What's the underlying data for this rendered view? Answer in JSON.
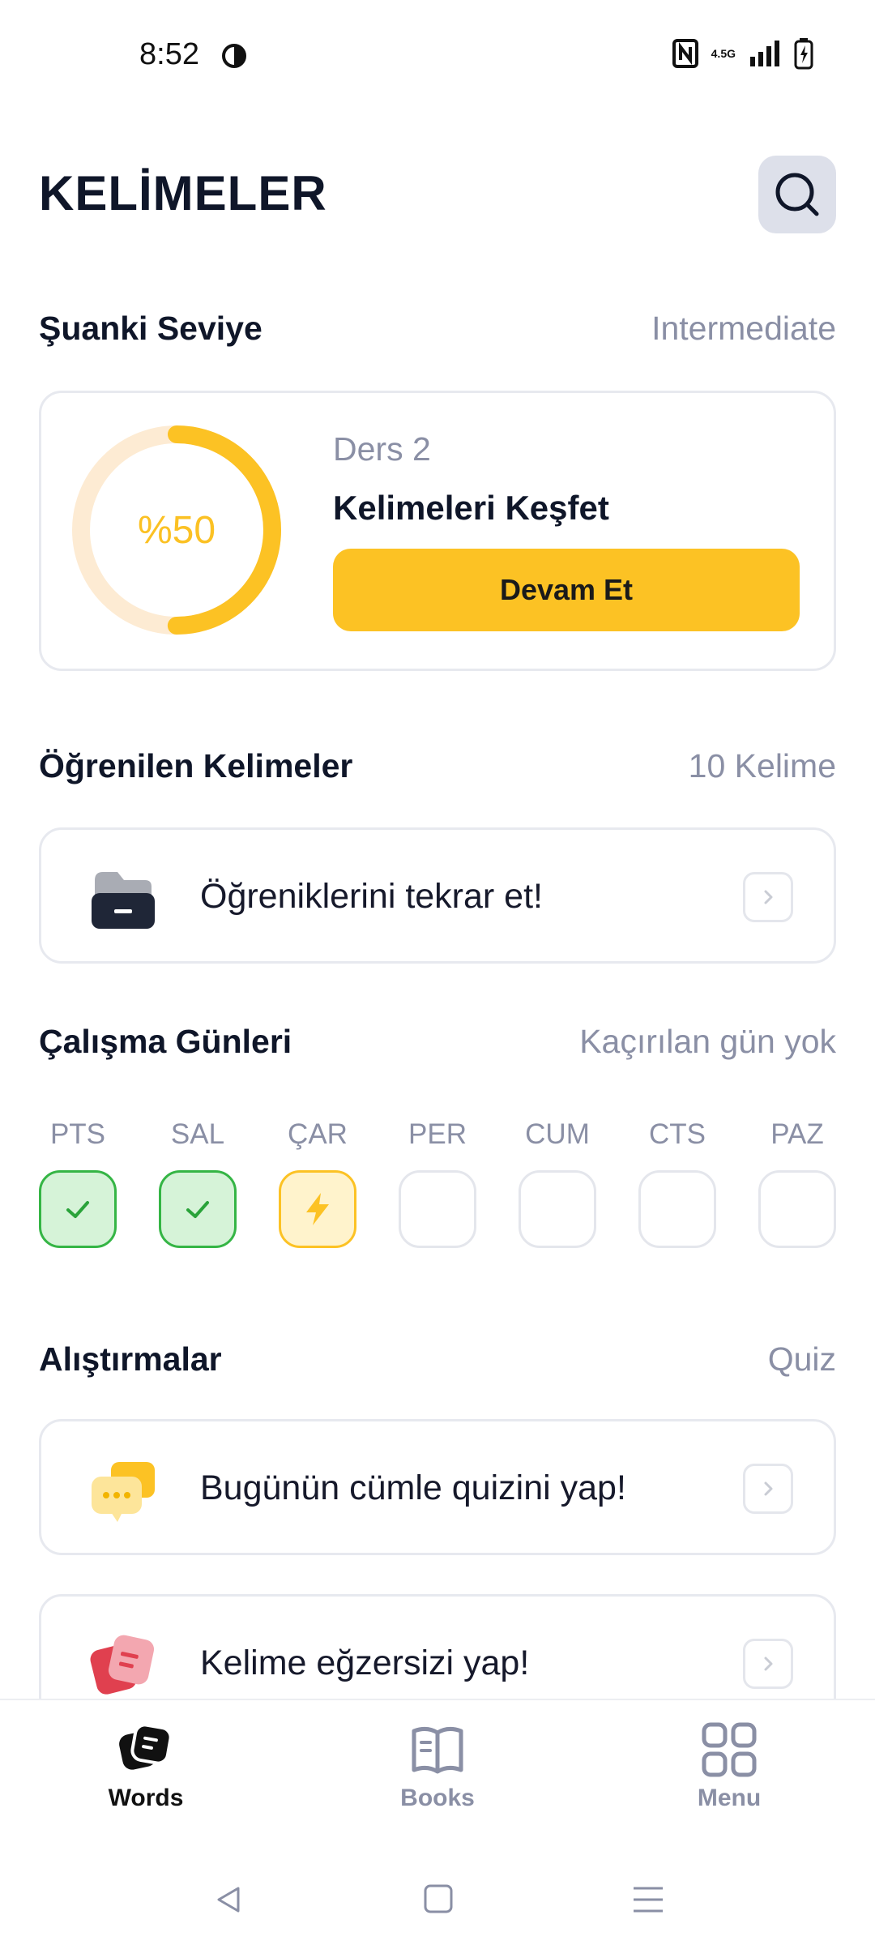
{
  "status": {
    "time": "8:52",
    "network": "4.5G"
  },
  "header": {
    "title": "KELİMELER"
  },
  "level": {
    "label": "Şuanki Seviye",
    "value": "Intermediate",
    "progress_text": "%50",
    "progress": 0.5,
    "lesson_sub": "Ders 2",
    "lesson_name": "Kelimeleri Keşfet",
    "continue_label": "Devam Et"
  },
  "learned": {
    "label": "Öğrenilen Kelimeler",
    "count": "10 Kelime",
    "review_label": "Öğreniklerini tekrar et!"
  },
  "study_days": {
    "label": "Çalışma Günleri",
    "status": "Kaçırılan gün yok",
    "days": [
      {
        "name": "PTS",
        "state": "done"
      },
      {
        "name": "SAL",
        "state": "done"
      },
      {
        "name": "ÇAR",
        "state": "today"
      },
      {
        "name": "PER",
        "state": "empty"
      },
      {
        "name": "CUM",
        "state": "empty"
      },
      {
        "name": "CTS",
        "state": "empty"
      },
      {
        "name": "PAZ",
        "state": "empty"
      }
    ]
  },
  "exercises": {
    "label": "Alıştırmalar",
    "link": "Quiz",
    "items": [
      {
        "label": "Bugünün cümle quizini yap!",
        "icon": "chat-bubbles-icon"
      },
      {
        "label": "Kelime eğzersizi yap!",
        "icon": "word-cards-icon"
      }
    ]
  },
  "nav": {
    "items": [
      {
        "label": "Words",
        "icon": "words-icon",
        "active": true
      },
      {
        "label": "Books",
        "icon": "book-icon",
        "active": false
      },
      {
        "label": "Menu",
        "icon": "grid-icon",
        "active": false
      }
    ]
  },
  "colors": {
    "accent": "#fcc224",
    "done": "#35b545",
    "muted": "#8a8fa5",
    "text": "#0f1629"
  }
}
